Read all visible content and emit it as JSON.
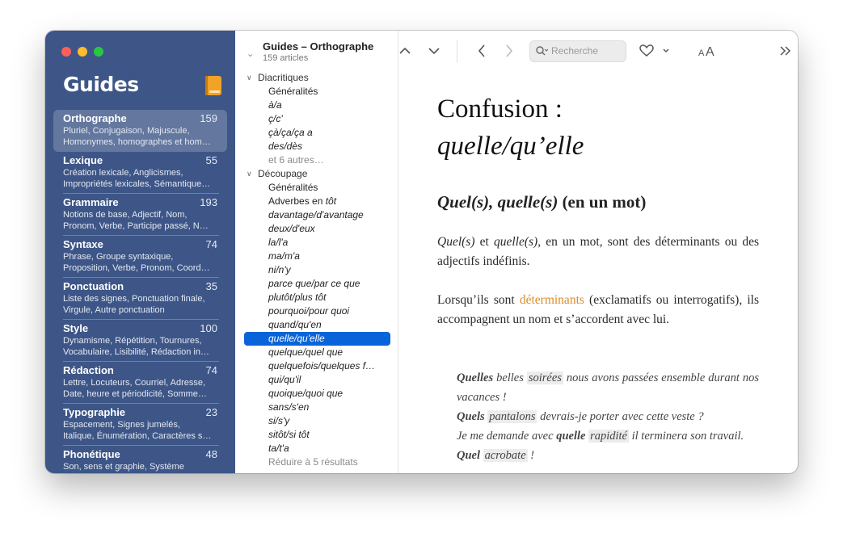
{
  "sidebar": {
    "title": "Guides",
    "categories": [
      {
        "name": "Orthographe",
        "count": "159",
        "desc1": "Pluriel, Conjugaison, Majuscule,",
        "desc2": "Homonymes, homographes et hom…"
      },
      {
        "name": "Lexique",
        "count": "55",
        "desc1": "Création lexicale, Anglicismes,",
        "desc2": "Impropriétés lexicales, Sémantique…"
      },
      {
        "name": "Grammaire",
        "count": "193",
        "desc1": "Notions de base, Adjectif, Nom,",
        "desc2": "Pronom, Verbe, Participe passé, N…"
      },
      {
        "name": "Syntaxe",
        "count": "74",
        "desc1": "Phrase, Groupe syntaxique,",
        "desc2": "Proposition, Verbe, Pronom, Coord…"
      },
      {
        "name": "Ponctuation",
        "count": "35",
        "desc1": "Liste des signes, Ponctuation finale,",
        "desc2": "Virgule, Autre ponctuation"
      },
      {
        "name": "Style",
        "count": "100",
        "desc1": "Dynamisme, Répétition, Tournures,",
        "desc2": "Vocabulaire, Lisibilité, Rédaction in…"
      },
      {
        "name": "Rédaction",
        "count": "74",
        "desc1": "Lettre, Locuteurs, Courriel, Adresse,",
        "desc2": "Date, heure et périodicité, Somme…"
      },
      {
        "name": "Typographie",
        "count": "23",
        "desc1": "Espacement, Signes jumelés,",
        "desc2": "Italique, Énumération, Caractères s…"
      },
      {
        "name": "Phonétique",
        "count": "48",
        "desc1": "Son, sens et graphie, Système",
        "desc2": ""
      }
    ]
  },
  "list": {
    "title": "Guides – Orthographe",
    "subtitle": "159 articles",
    "sections": [
      {
        "name": "Diacritiques",
        "items": [
          {
            "t": "Généralités",
            "it": false
          },
          {
            "t": "à/a",
            "it": true
          },
          {
            "t": "ç/c'",
            "it": true
          },
          {
            "t": "çà/ça/ça a",
            "it": true
          },
          {
            "t": "des/dès",
            "it": true
          },
          {
            "t": "et 6 autres…",
            "it": false,
            "more": true
          }
        ]
      },
      {
        "name": "Découpage",
        "items": [
          {
            "t": "Généralités",
            "it": false
          },
          {
            "t": "Adverbes en tôt",
            "it": false,
            "mixed": true
          },
          {
            "t": "davantage/d'avantage",
            "it": true
          },
          {
            "t": "deux/d'eux",
            "it": true
          },
          {
            "t": "la/l'a",
            "it": true
          },
          {
            "t": "ma/m'a",
            "it": true
          },
          {
            "t": "ni/n'y",
            "it": true
          },
          {
            "t": "parce que/par ce que",
            "it": true
          },
          {
            "t": "plutôt/plus tôt",
            "it": true
          },
          {
            "t": "pourquoi/pour quoi",
            "it": true
          },
          {
            "t": "quand/qu'en",
            "it": true
          },
          {
            "t": "quelle/qu'elle",
            "it": true,
            "selected": true
          },
          {
            "t": "quelque/quel que",
            "it": true
          },
          {
            "t": "quelquefois/quelques f…",
            "it": true
          },
          {
            "t": "qui/qu'il",
            "it": true
          },
          {
            "t": "quoique/quoi que",
            "it": true
          },
          {
            "t": "sans/s'en",
            "it": true
          },
          {
            "t": "si/s'y",
            "it": true
          },
          {
            "t": "sitôt/si tôt",
            "it": true
          },
          {
            "t": "ta/t'a",
            "it": true
          },
          {
            "t": "Réduire à 5 résultats",
            "it": false,
            "more": true
          }
        ]
      }
    ]
  },
  "toolbar": {
    "search_placeholder": "Recherche"
  },
  "article": {
    "title_line1": "Confusion :",
    "title_line2": "quelle/qu’elle",
    "h2_italic": "Quel(s), quelle(s)",
    "h2_rest": "(en un mot)",
    "p1_a": "Quel(s)",
    "p1_b": " et ",
    "p1_c": "quelle(s)",
    "p1_d": ", en un mot, sont des déterminants ou des adjectifs indéfinis.",
    "p2_a": "Lorsqu’ils sont ",
    "p2_link": "déterminants",
    "p2_b": " (exclamatifs ou interrogatifs), ils accompagnent un nom et s’accordent avec lui.",
    "ex1_bold": "Quelles",
    "ex1_a": " belles ",
    "ex1_hl": "soirées",
    "ex1_b": " nous avons passées ensemble durant nos vacances !",
    "ex2_bold": "Quels",
    "ex2_hl": "pantalons",
    "ex2_b": " devrais-je porter avec cette veste ?",
    "ex3_a": "Je me demande avec ",
    "ex3_bold": "quelle",
    "ex3_hl": "rapidité",
    "ex3_b": " il terminera son travail.",
    "ex4_bold": "Quel",
    "ex4_hl": "acrobate",
    "ex4_b": " !"
  }
}
